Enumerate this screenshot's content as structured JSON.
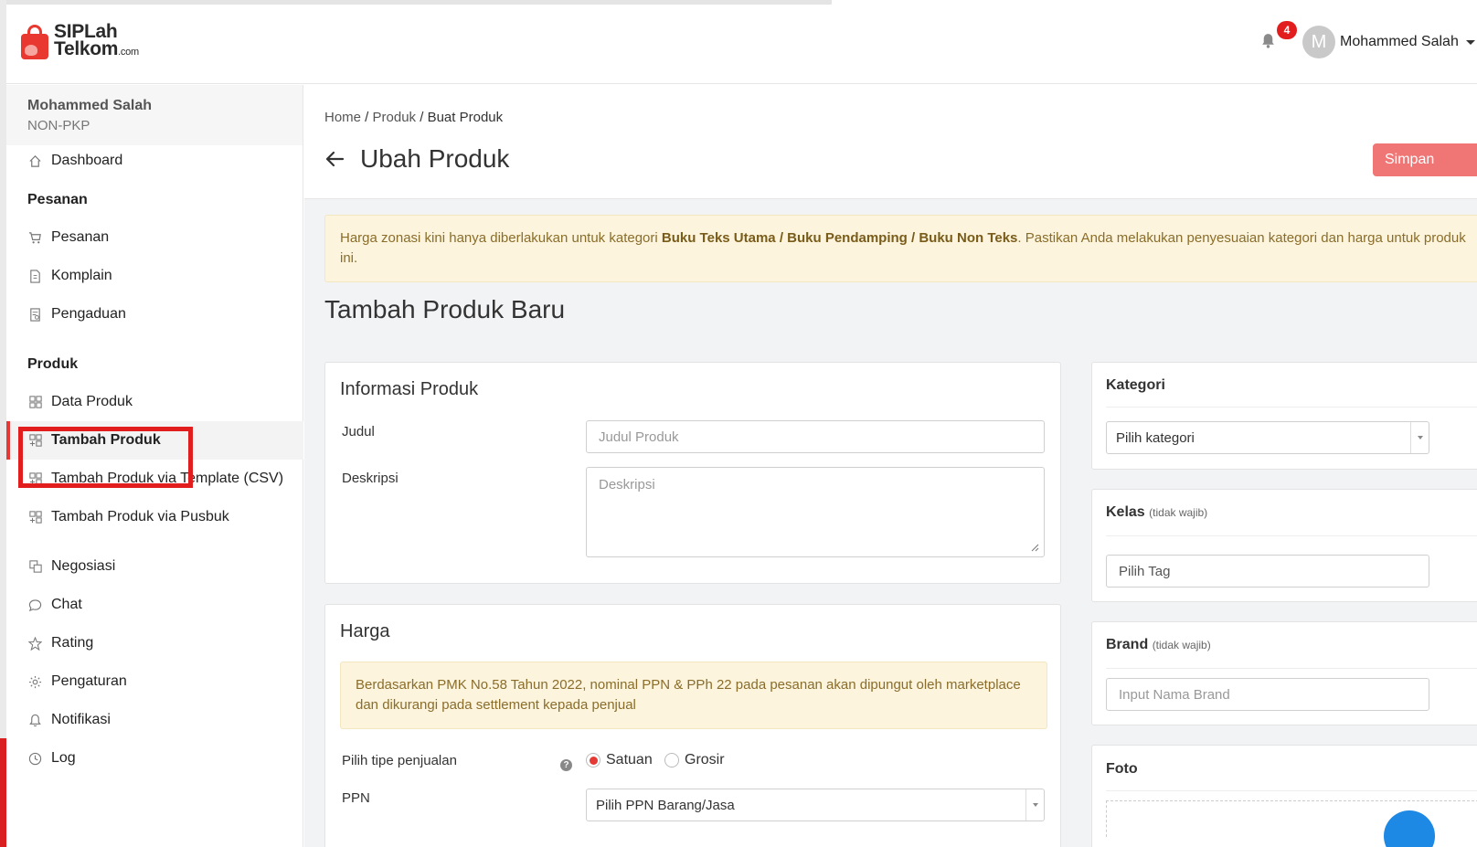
{
  "header": {
    "logo_line1": "SIPLah",
    "logo_line2": "Telkom",
    "logo_suffix": ".com",
    "notification_count": "4",
    "avatar_initial": "M",
    "user_name": "Mohammed Salah"
  },
  "sidebar": {
    "user_name": "Mohammed Salah",
    "user_status": "NON-PKP",
    "dashboard": "Dashboard",
    "section_pesanan": "Pesanan",
    "pesanan": "Pesanan",
    "komplain": "Komplain",
    "pengaduan": "Pengaduan",
    "section_produk": "Produk",
    "data_produk": "Data Produk",
    "tambah_produk": "Tambah Produk",
    "tambah_csv": "Tambah Produk via Template (CSV)",
    "tambah_pusbuk": "Tambah Produk via Pusbuk",
    "negosiasi": "Negosiasi",
    "chat": "Chat",
    "rating": "Rating",
    "pengaturan": "Pengaturan",
    "notifikasi": "Notifikasi",
    "log": "Log"
  },
  "page": {
    "breadcrumb_home": "Home",
    "breadcrumb_sep1": " / ",
    "breadcrumb_produk": "Produk",
    "breadcrumb_sep2": " / ",
    "breadcrumb_current": "Buat Produk",
    "title": "Ubah Produk",
    "save_label": "Simpan",
    "alert_pre": "Harga zonasi kini hanya diberlakukan untuk kategori ",
    "alert_bold": "Buku Teks Utama / Buku Pendamping / Buku Non Teks",
    "alert_post": ". Pastikan Anda melakukan penyesuaian kategori dan harga untuk produk ini.",
    "form_title": "Tambah Produk Baru"
  },
  "info_card": {
    "title": "Informasi Produk",
    "judul_label": "Judul",
    "judul_placeholder": "Judul Produk",
    "deskripsi_label": "Deskripsi",
    "deskripsi_placeholder": "Deskripsi"
  },
  "harga_card": {
    "title": "Harga",
    "note": "Berdasarkan PMK No.58 Tahun 2022, nominal PPN & PPh 22 pada pesanan akan dipungut oleh marketplace dan dikurangi pada settlement kepada penjual",
    "tipe_label": "Pilih tipe penjualan",
    "help": "?",
    "radio_satuan": "Satuan",
    "radio_grosir": "Grosir",
    "selected_tipe": "Satuan",
    "ppn_label": "PPN",
    "ppn_select": "Pilih PPN Barang/Jasa"
  },
  "right_panel": {
    "kategori_title": "Kategori",
    "kategori_select": "Pilih kategori",
    "kelas_title": "Kelas",
    "kelas_optional": "(tidak wajib)",
    "kelas_placeholder": "Pilih Tag",
    "brand_title": "Brand",
    "brand_optional": "(tidak wajib)",
    "brand_placeholder": "Input Nama Brand",
    "foto_title": "Foto"
  },
  "colors": {
    "accent_red": "#e53935",
    "save_button": "#f07575",
    "alert_bg": "#fcf4dd",
    "alert_text": "#8a6d2b"
  }
}
